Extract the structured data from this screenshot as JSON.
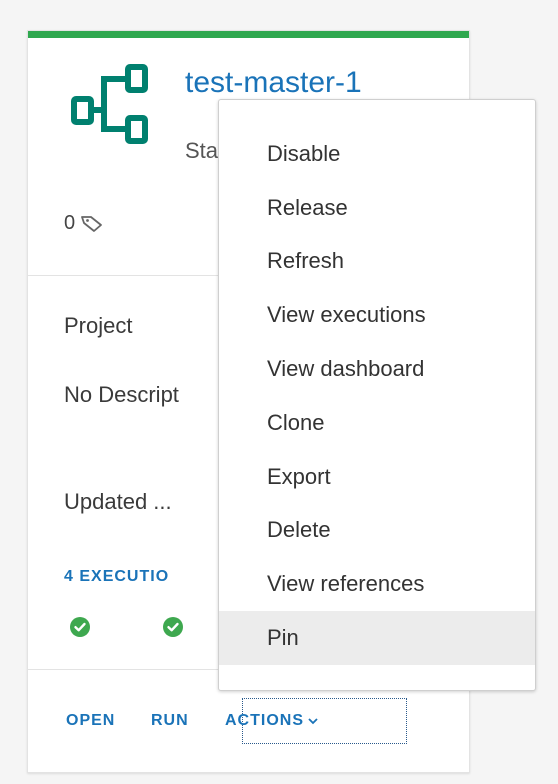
{
  "colors": {
    "accent_bar": "#2fa84f",
    "icon_teal": "#00806f",
    "link_blue": "#1a73b8",
    "success_green": "#3ea84f",
    "menu_hover": "#ececec"
  },
  "card": {
    "title": "test-master-1",
    "status_partial": "Sta",
    "tag_count": "0",
    "project_label": "Project",
    "description_partial": "No Descript",
    "updated_partial": "Updated ...",
    "executions_link_partial": "4 EXECUTIO",
    "execution_status_icons": [
      "success-check-icon",
      "success-check-icon"
    ],
    "actions": {
      "open_label": "OPEN",
      "run_label": "RUN",
      "actions_label": "ACTIONS"
    }
  },
  "actions_menu": {
    "items": [
      {
        "label": "Disable"
      },
      {
        "label": "Release"
      },
      {
        "label": "Refresh"
      },
      {
        "label": "View executions"
      },
      {
        "label": "View dashboard"
      },
      {
        "label": "Clone"
      },
      {
        "label": "Export"
      },
      {
        "label": "Delete"
      },
      {
        "label": "View references"
      },
      {
        "label": "Pin",
        "highlighted": true
      }
    ]
  }
}
